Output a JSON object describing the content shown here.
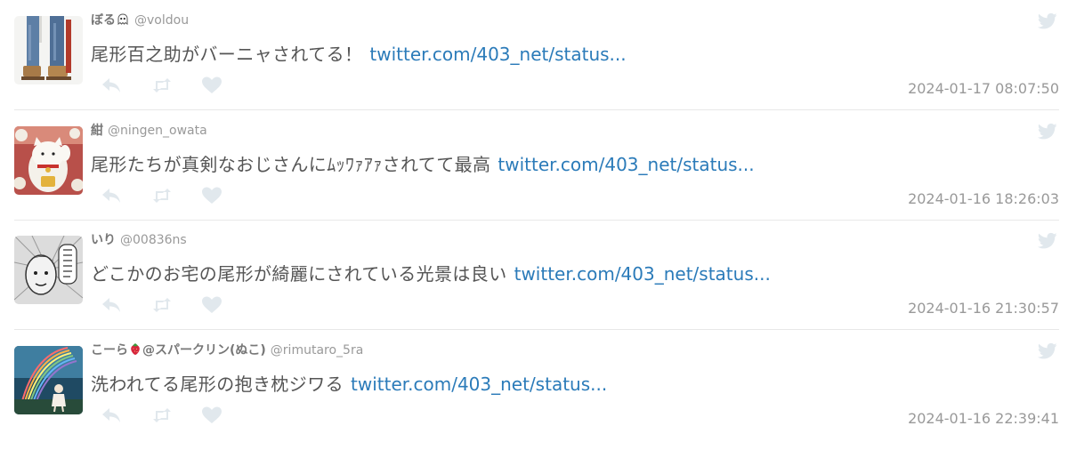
{
  "tweets": [
    {
      "display_name": "ぼる",
      "name_emoji": "ghost-emoji",
      "screen_name": "@voldou",
      "text": "尾形百之助がバーニャされてる！",
      "link": "twitter.com/403_net/status...",
      "timestamp": "2024-01-17 08:07:50",
      "avatar": "legs-jeans-avatar"
    },
    {
      "display_name": "紺",
      "screen_name": "@ningen_owata",
      "text": "尾形たちが真剣なおじさんにﾑｯﾜｧｱｧされてて最高",
      "link": "twitter.com/403_net/status...",
      "timestamp": "2024-01-16 18:26:03",
      "avatar": "maneki-neko-avatar"
    },
    {
      "display_name": "いり",
      "screen_name": "@00836ns",
      "text": "どこかのお宅の尾形が綺麗にされている光景は良い",
      "link": "twitter.com/403_net/status...",
      "timestamp": "2024-01-16 21:30:57",
      "avatar": "manga-face-avatar"
    },
    {
      "display_name_prefix": "こーら",
      "name_emoji": "strawberry-emoji",
      "display_name_suffix": "@スパークリン(ぬこ)",
      "screen_name": "@rimutaro_5ra",
      "text": "洗われてる尾形の抱き枕ジワる",
      "link": "twitter.com/403_net/status...",
      "timestamp": "2024-01-16 22:39:41",
      "avatar": "rainbow-figure-avatar"
    }
  ],
  "icons": {
    "reply": "reply-icon",
    "retweet": "retweet-icon",
    "like": "heart-icon",
    "source": "twitter-bird-icon"
  },
  "colors": {
    "link": "#2b7bb9",
    "icon": "#e1e8ed",
    "display_name": "#777777",
    "meta": "#999999",
    "text": "#555555"
  }
}
